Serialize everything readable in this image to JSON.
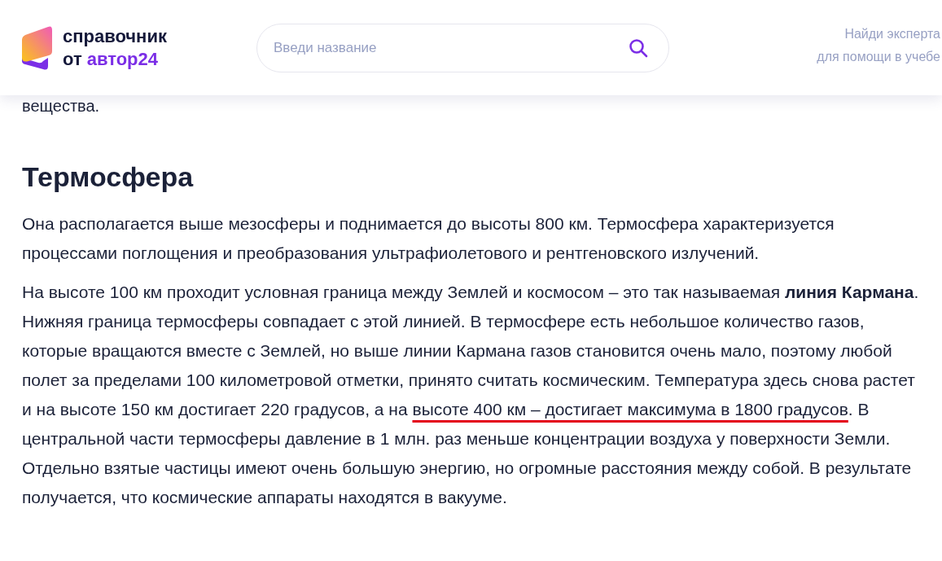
{
  "header": {
    "logo": {
      "line_1": "справочник",
      "line_2_prefix": "от",
      "line_2_brand": "автор24"
    },
    "search": {
      "placeholder": "Введи название"
    },
    "expert_link": {
      "line_1": "Найди эксперта",
      "line_2": "для помощи в учебе"
    }
  },
  "article": {
    "cut_text": "вещества.",
    "heading": "Термосфера",
    "paragraphs": [
      [
        {
          "kind": "plain",
          "text": "Она располагается выше мезосферы и поднимается до высоты 800 км. Термосфера характеризуется процессами поглощения и преобразования ультрафиолетового и рентгеновского излучений."
        }
      ],
      [
        {
          "kind": "plain",
          "text": "На высоте 100 км проходит условная граница между Землей и космосом – это так называемая "
        },
        {
          "kind": "bold",
          "text": "линия Кармана"
        },
        {
          "kind": "plain",
          "text": ". Нижняя граница термосферы совпадает с этой линией. В термосфере есть небольшое количество газов, которые вращаются вместе с Землей, но выше линии Кармана газов становится очень мало, поэтому любой полет за пределами 100 километровой отметки, принято считать космическим. Температура здесь снова растет и на высоте 150 км достигает 220 градусов, а на "
        },
        {
          "kind": "underlined",
          "text": "высоте 400 км – достигает максимума в 1800 градусов"
        },
        {
          "kind": "plain",
          "text": ". В центральной части термосферы давление в 1 млн. раз меньше концентрации воздуха у поверхности Земли. Отдельно взятые частицы имеют очень большую энергию, но огромные расстояния между собой. В результате получается, что космические аппараты находятся в вакууме."
        }
      ]
    ]
  }
}
